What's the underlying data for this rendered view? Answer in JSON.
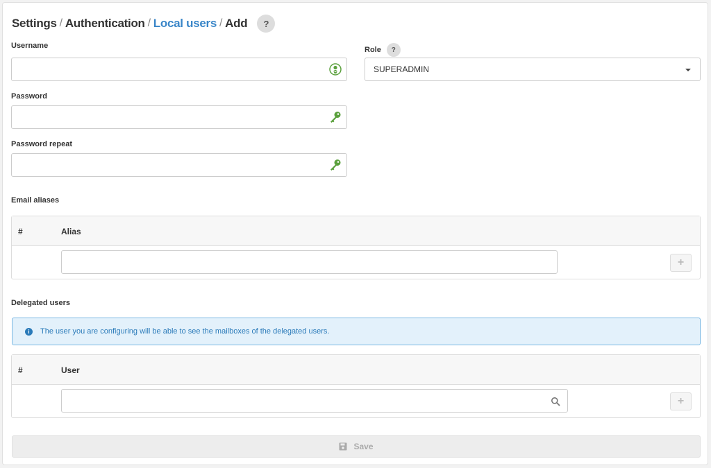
{
  "breadcrumb": {
    "settings": "Settings",
    "authentication": "Authentication",
    "local_users": "Local users",
    "add": "Add",
    "sep": "/"
  },
  "help": {
    "symbol": "?"
  },
  "form": {
    "username_label": "Username",
    "username_value": "",
    "password_label": "Password",
    "password_value": "",
    "password_repeat_label": "Password repeat",
    "password_repeat_value": "",
    "role_label": "Role",
    "role_selected": "SUPERADMIN"
  },
  "email_aliases": {
    "section_label": "Email aliases",
    "columns": [
      "#",
      "Alias"
    ],
    "new_alias_value": "",
    "add_symbol": "+"
  },
  "delegated_users": {
    "section_label": "Delegated users",
    "info_text": "The user you are configuring will be able to see the mailboxes of the delegated users.",
    "info_icon": "i",
    "columns": [
      "#",
      "User"
    ],
    "new_user_value": "",
    "add_symbol": "+"
  },
  "save_button": {
    "label": "Save"
  },
  "icons": {
    "username_icon": "user-badge-icon",
    "password_icon": "key-icon",
    "search_icon": "search-icon",
    "save_icon": "floppy-disk-icon"
  },
  "colors": {
    "link": "#3a86c8",
    "icon_green": "#5aa03c",
    "info_bg": "#e3f1fb",
    "info_border": "#79b7e3",
    "info_text": "#2a7ab9"
  }
}
